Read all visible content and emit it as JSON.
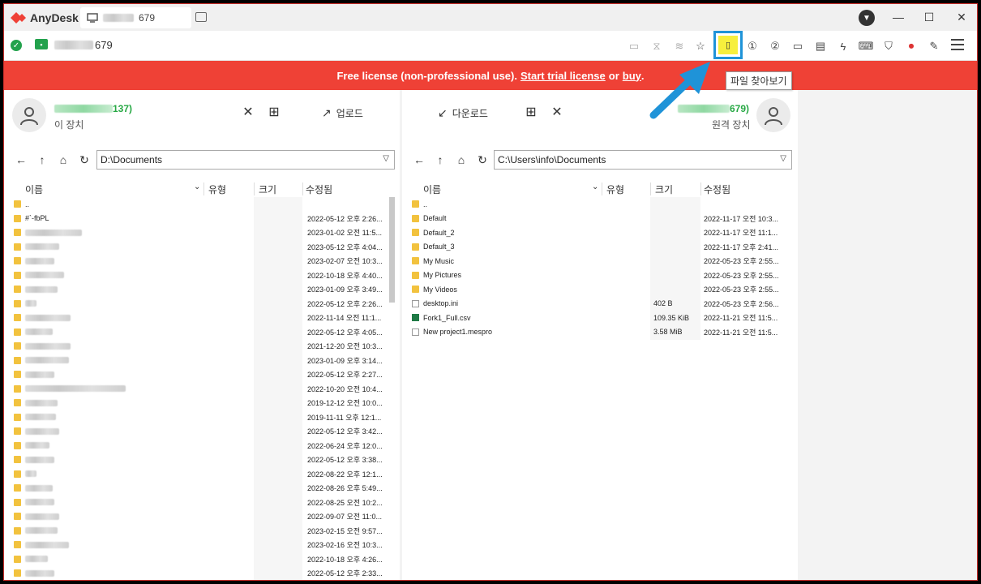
{
  "app": {
    "name": "AnyDesk",
    "tab_label": "679",
    "remote_addr": "679"
  },
  "window": {
    "minimize": "—",
    "maximize": "☐",
    "close": "✕"
  },
  "toolbar": {
    "file_browser_tooltip": "파일 찾아보기"
  },
  "banner": {
    "prefix": "Free license (non-professional use).",
    "trial_link": "Start trial license",
    "mid": "or",
    "buy_link": "buy",
    "suffix": "."
  },
  "left": {
    "device_id": "137)",
    "device_label": "이 장치",
    "upload_label": "업로드",
    "path": "D:\\Documents",
    "columns": {
      "name": "이름",
      "type": "유형",
      "size": "크기",
      "modified": "수정됨"
    },
    "rows": [
      {
        "name": "..",
        "date": ""
      },
      {
        "name": "#`-fbPL",
        "date": "2022-05-12 오후 2:26..."
      },
      {
        "name": "",
        "date": "2023-01-02 오전 11:5..."
      },
      {
        "name": "",
        "date": "2023-05-12 오후 4:04..."
      },
      {
        "name": "",
        "date": "2023-02-07 오전 10:3..."
      },
      {
        "name": "",
        "date": "2022-10-18 오후 4:40..."
      },
      {
        "name": "",
        "date": "2023-01-09 오후 3:49..."
      },
      {
        "name": "",
        "date": "2022-05-12 오후 2:26..."
      },
      {
        "name": "",
        "date": "2022-11-14 오전 11:1..."
      },
      {
        "name": "",
        "date": "2022-05-12 오후 4:05..."
      },
      {
        "name": "",
        "date": "2021-12-20 오전 10:3..."
      },
      {
        "name": "",
        "date": "2023-01-09 오후 3:14..."
      },
      {
        "name": "",
        "date": "2022-05-12 오후 2:27..."
      },
      {
        "name": "",
        "date": "2022-10-20 오전 10:4..."
      },
      {
        "name": "",
        "date": "2019-12-12 오전 10:0..."
      },
      {
        "name": "",
        "date": "2019-11-11 오후 12:1..."
      },
      {
        "name": "",
        "date": "2022-05-12 오후 3:42..."
      },
      {
        "name": "",
        "date": "2022-06-24 오후 12:0..."
      },
      {
        "name": "",
        "date": "2022-05-12 오후 3:38..."
      },
      {
        "name": "",
        "date": "2022-08-22 오후 12:1..."
      },
      {
        "name": "",
        "date": "2022-08-26 오후 5:49..."
      },
      {
        "name": "",
        "date": "2022-08-25 오전 10:2..."
      },
      {
        "name": "",
        "date": "2022-09-07 오전 11:0..."
      },
      {
        "name": "",
        "date": "2023-02-15 오전 9:57..."
      },
      {
        "name": "",
        "date": "2023-02-16 오전 10:3..."
      },
      {
        "name": "",
        "date": "2022-10-18 오후 4:26..."
      },
      {
        "name": "",
        "date": "2022-05-12 오후 2:33..."
      }
    ]
  },
  "right": {
    "device_id": "679)",
    "device_label": "원격 장치",
    "download_label": "다운로드",
    "path": "C:\\Users\\info\\Documents",
    "columns": {
      "name": "이름",
      "type": "유형",
      "size": "크기",
      "modified": "수정됨"
    },
    "rows": [
      {
        "icon": "folder",
        "name": "..",
        "size": "",
        "date": ""
      },
      {
        "icon": "folder",
        "name": "Default",
        "size": "",
        "date": "2022-11-17 오전 10:3..."
      },
      {
        "icon": "folder",
        "name": "Default_2",
        "size": "",
        "date": "2022-11-17 오전 11:1..."
      },
      {
        "icon": "folder",
        "name": "Default_3",
        "size": "",
        "date": "2022-11-17 오후 2:41..."
      },
      {
        "icon": "folder",
        "name": "My Music",
        "size": "",
        "date": "2022-05-23 오후 2:55..."
      },
      {
        "icon": "folder",
        "name": "My Pictures",
        "size": "",
        "date": "2022-05-23 오후 2:55..."
      },
      {
        "icon": "folder",
        "name": "My Videos",
        "size": "",
        "date": "2022-05-23 오후 2:55..."
      },
      {
        "icon": "file",
        "name": "desktop.ini",
        "size": "402 B",
        "date": "2022-05-23 오후 2:56..."
      },
      {
        "icon": "excel",
        "name": "Fork1_Full.csv",
        "size": "109.35 KiB",
        "date": "2022-11-21 오전 11:5..."
      },
      {
        "icon": "file",
        "name": "New project1.mespro",
        "size": "3.58 MiB",
        "date": "2022-11-21 오전 11:5..."
      }
    ]
  },
  "colors": {
    "accent_red": "#ef4136",
    "green": "#27a844",
    "highlight_yellow": "#f7ef3d",
    "callout_blue": "#1f93d8"
  }
}
